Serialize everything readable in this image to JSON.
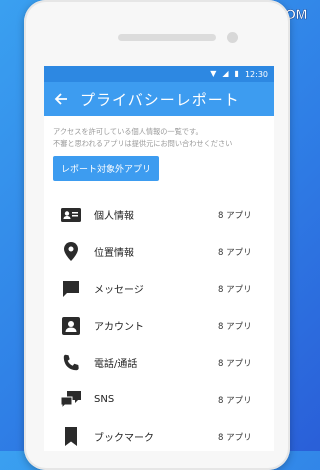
{
  "watermark": "RBBTODAY.COM",
  "status_bar": {
    "time": "12:30"
  },
  "app_bar": {
    "title": "プライバシーレポート"
  },
  "description": {
    "line1": "アクセスを許可している個人情報の一覧です。",
    "line2": "不審と思われるアプリは提供元にお問い合わせください"
  },
  "exclude_button": {
    "label": "レポート対象外アプリ"
  },
  "items": [
    {
      "label": "個人情報",
      "count": "8 アプリ",
      "icon": "id-card-icon"
    },
    {
      "label": "位置情報",
      "count": "8 アプリ",
      "icon": "location-pin-icon"
    },
    {
      "label": "メッセージ",
      "count": "8 アプリ",
      "icon": "message-icon"
    },
    {
      "label": "アカウント",
      "count": "8 アプリ",
      "icon": "account-icon"
    },
    {
      "label": "電話/通話",
      "count": "8 アプリ",
      "icon": "phone-icon"
    },
    {
      "label": "SNS",
      "count": "8 アプリ",
      "icon": "chat-bubbles-icon"
    },
    {
      "label": "ブックマーク",
      "count": "8 アプリ",
      "icon": "bookmark-icon"
    }
  ],
  "colors": {
    "appbar": "#3d9cf0",
    "statusbar": "#2d88e2",
    "icon": "#2b2b2b"
  }
}
